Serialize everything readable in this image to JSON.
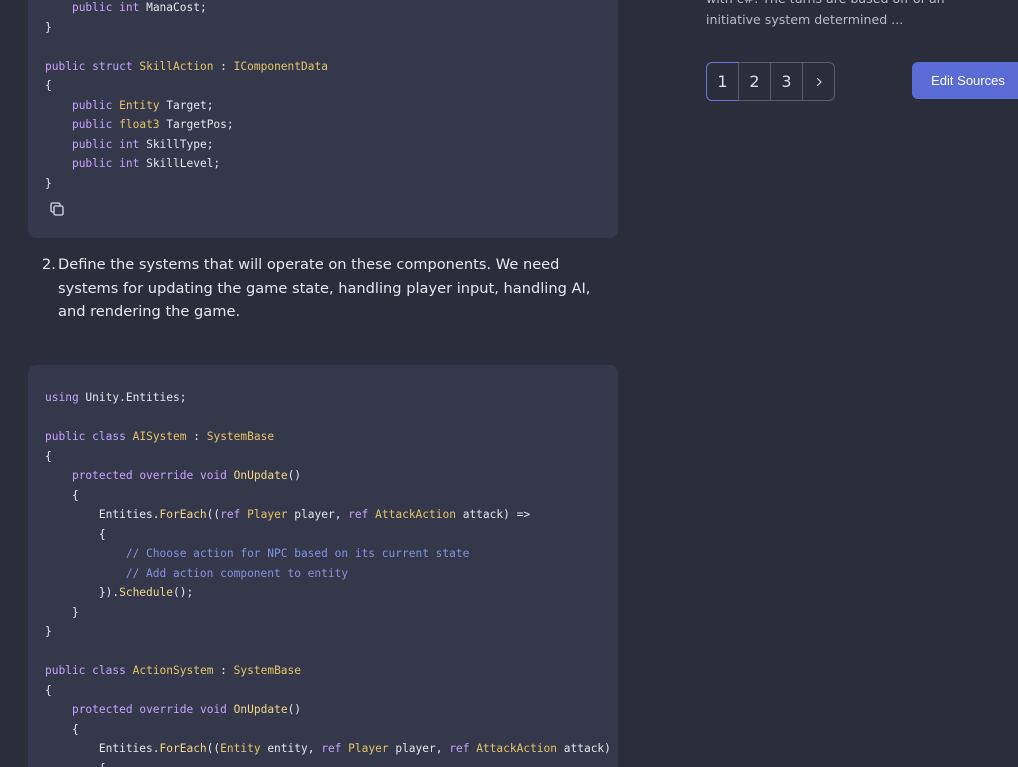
{
  "code_block_1": {
    "lines": [
      [
        {
          "t": "    "
        },
        {
          "t": "public",
          "c": "kw"
        },
        {
          "t": " "
        },
        {
          "t": "int",
          "c": "kw"
        },
        {
          "t": " ManaCost;"
        }
      ],
      [
        {
          "t": "}"
        }
      ],
      [
        {
          "t": ""
        }
      ],
      [
        {
          "t": "public",
          "c": "kw"
        },
        {
          "t": " "
        },
        {
          "t": "struct",
          "c": "kw"
        },
        {
          "t": " "
        },
        {
          "t": "SkillAction",
          "c": "ty"
        },
        {
          "t": " : "
        },
        {
          "t": "IComponentData",
          "c": "ty"
        }
      ],
      [
        {
          "t": "{"
        }
      ],
      [
        {
          "t": "    "
        },
        {
          "t": "public",
          "c": "kw"
        },
        {
          "t": " "
        },
        {
          "t": "Entity",
          "c": "ty"
        },
        {
          "t": " Target;"
        }
      ],
      [
        {
          "t": "    "
        },
        {
          "t": "public",
          "c": "kw"
        },
        {
          "t": " "
        },
        {
          "t": "float3",
          "c": "ty"
        },
        {
          "t": " TargetPos;"
        }
      ],
      [
        {
          "t": "    "
        },
        {
          "t": "public",
          "c": "kw"
        },
        {
          "t": " "
        },
        {
          "t": "int",
          "c": "kw"
        },
        {
          "t": " SkillType;"
        }
      ],
      [
        {
          "t": "    "
        },
        {
          "t": "public",
          "c": "kw"
        },
        {
          "t": " "
        },
        {
          "t": "int",
          "c": "kw"
        },
        {
          "t": " SkillLevel;"
        }
      ],
      [
        {
          "t": "}"
        }
      ]
    ]
  },
  "list_item": {
    "number": "2.",
    "text": "Define the systems that will operate on these components. We need systems for updating the game state, handling player input, handling AI, and rendering the game."
  },
  "code_block_2": {
    "lines": [
      [
        {
          "t": "using",
          "c": "kw"
        },
        {
          "t": " Unity.Entities;"
        }
      ],
      [
        {
          "t": ""
        }
      ],
      [
        {
          "t": "public",
          "c": "kw"
        },
        {
          "t": " "
        },
        {
          "t": "class",
          "c": "kw"
        },
        {
          "t": " "
        },
        {
          "t": "AISystem",
          "c": "ty"
        },
        {
          "t": " : "
        },
        {
          "t": "SystemBase",
          "c": "ty"
        }
      ],
      [
        {
          "t": "{"
        }
      ],
      [
        {
          "t": "    "
        },
        {
          "t": "protected",
          "c": "kw"
        },
        {
          "t": " "
        },
        {
          "t": "override",
          "c": "kw"
        },
        {
          "t": " "
        },
        {
          "t": "void",
          "c": "kw"
        },
        {
          "t": " "
        },
        {
          "t": "OnUpdate",
          "c": "fn"
        },
        {
          "t": "()"
        }
      ],
      [
        {
          "t": "    {"
        }
      ],
      [
        {
          "t": "        Entities."
        },
        {
          "t": "ForEach",
          "c": "fn"
        },
        {
          "t": "(("
        },
        {
          "t": "ref",
          "c": "kw"
        },
        {
          "t": " "
        },
        {
          "t": "Player",
          "c": "ty"
        },
        {
          "t": " player, "
        },
        {
          "t": "ref",
          "c": "kw"
        },
        {
          "t": " "
        },
        {
          "t": "AttackAction",
          "c": "ty"
        },
        {
          "t": " attack) =>"
        }
      ],
      [
        {
          "t": "        {"
        }
      ],
      [
        {
          "t": "            "
        },
        {
          "t": "// Choose action for NPC based on its current state",
          "c": "cm"
        }
      ],
      [
        {
          "t": "            "
        },
        {
          "t": "// Add action component to entity",
          "c": "cm"
        }
      ],
      [
        {
          "t": "        })."
        },
        {
          "t": "Schedule",
          "c": "fn"
        },
        {
          "t": "();"
        }
      ],
      [
        {
          "t": "    }"
        }
      ],
      [
        {
          "t": "}"
        }
      ],
      [
        {
          "t": ""
        }
      ],
      [
        {
          "t": "public",
          "c": "kw"
        },
        {
          "t": " "
        },
        {
          "t": "class",
          "c": "kw"
        },
        {
          "t": " "
        },
        {
          "t": "ActionSystem",
          "c": "ty"
        },
        {
          "t": " : "
        },
        {
          "t": "SystemBase",
          "c": "ty"
        }
      ],
      [
        {
          "t": "{"
        }
      ],
      [
        {
          "t": "    "
        },
        {
          "t": "protected",
          "c": "kw"
        },
        {
          "t": " "
        },
        {
          "t": "override",
          "c": "kw"
        },
        {
          "t": " "
        },
        {
          "t": "void",
          "c": "kw"
        },
        {
          "t": " "
        },
        {
          "t": "OnUpdate",
          "c": "fn"
        },
        {
          "t": "()"
        }
      ],
      [
        {
          "t": "    {"
        }
      ],
      [
        {
          "t": "        Entities."
        },
        {
          "t": "ForEach",
          "c": "fn"
        },
        {
          "t": "(("
        },
        {
          "t": "Entity",
          "c": "ty"
        },
        {
          "t": " entity, "
        },
        {
          "t": "ref",
          "c": "kw"
        },
        {
          "t": " "
        },
        {
          "t": "Player",
          "c": "ty"
        },
        {
          "t": " player, "
        },
        {
          "t": "ref",
          "c": "kw"
        },
        {
          "t": " "
        },
        {
          "t": "AttackAction",
          "c": "ty"
        },
        {
          "t": " attack) =>"
        }
      ],
      [
        {
          "t": "        {"
        }
      ]
    ]
  },
  "sidebar": {
    "snippet": "with c#. The turns are based off of an initiative system determined ...",
    "pages": [
      "1",
      "2",
      "3"
    ],
    "active_page": "1",
    "next_icon": "chevron-right-icon",
    "edit_sources_label": "Edit Sources"
  },
  "colors": {
    "background": "#2b2d3a",
    "code_bg": "#35374a",
    "accent": "#5b6bd6",
    "keyword": "#c7a3ff",
    "type": "#e2c66b",
    "comment": "#8592e0"
  }
}
